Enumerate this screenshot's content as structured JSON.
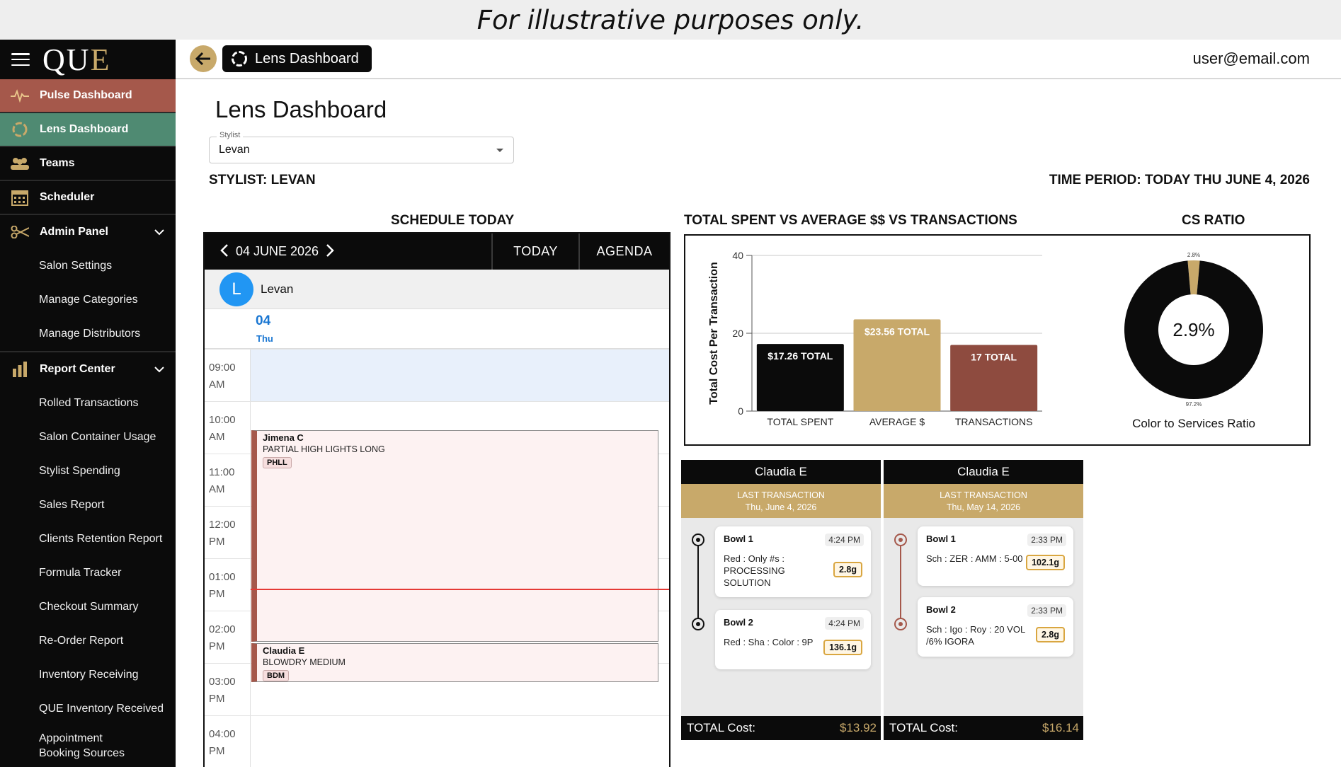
{
  "banner": "For illustrative purposes only.",
  "sidebar": {
    "logo_main": "QU",
    "logo_accent": "E",
    "items": [
      {
        "label": "Pulse Dashboard",
        "icon": "pulse-icon"
      },
      {
        "label": "Lens Dashboard",
        "icon": "lens-icon"
      },
      {
        "label": "Teams",
        "icon": "teams-icon"
      },
      {
        "label": "Scheduler",
        "icon": "calendar-icon"
      },
      {
        "label": "Admin Panel",
        "icon": "scissors-icon"
      },
      {
        "label": "Report Center",
        "icon": "bar-chart-icon"
      }
    ],
    "admin_sub": [
      "Salon Settings",
      "Manage Categories",
      "Manage Distributors"
    ],
    "report_sub": [
      "Rolled Transactions",
      "Salon Container Usage",
      "Stylist Spending",
      "Sales Report",
      "Clients Retention Report",
      "Formula Tracker",
      "Checkout Summary",
      "Re-Order Report",
      "Inventory Receiving",
      "QUE Inventory Received",
      "Appointment Booking Sources"
    ]
  },
  "topbar": {
    "crumb": "Lens Dashboard",
    "user": "user@email.com"
  },
  "page": {
    "title": "Lens Dashboard",
    "stylist_label": "Stylist",
    "stylist_value": "Levan",
    "stylist_heading": "STYLIST: LEVAN",
    "period_heading": "TIME PERIOD: TODAY THU JUNE 4, 2026"
  },
  "schedule": {
    "title": "SCHEDULE TODAY",
    "date": "04 JUNE 2026",
    "today": "TODAY",
    "agenda": "AGENDA",
    "resource_initial": "L",
    "resource_name": "Levan",
    "day_num": "04",
    "day_name": "Thu",
    "times": [
      {
        "h": "09:00",
        "ap": "AM"
      },
      {
        "h": "10:00",
        "ap": "AM"
      },
      {
        "h": "11:00",
        "ap": "AM"
      },
      {
        "h": "12:00",
        "ap": "PM"
      },
      {
        "h": "01:00",
        "ap": "PM"
      },
      {
        "h": "02:00",
        "ap": "PM"
      },
      {
        "h": "03:00",
        "ap": "PM"
      },
      {
        "h": "04:00",
        "ap": "PM"
      }
    ],
    "appointments": [
      {
        "client": "Jimena C",
        "service": "PARTIAL HIGH LIGHTS LONG",
        "code": "PHLL"
      },
      {
        "client": "Claudia E",
        "service": "BLOWDRY MEDIUM",
        "code": "BDM"
      }
    ]
  },
  "chart_title": "TOTAL SPENT VS AVERAGE $$ VS TRANSACTIONS",
  "cs_title": "CS RATIO",
  "chart_data": [
    {
      "type": "bar",
      "categories": [
        "TOTAL SPENT",
        "AVERAGE $",
        "TRANSACTIONS"
      ],
      "values": [
        17.26,
        23.56,
        17
      ],
      "data_labels": [
        "$17.26 TOTAL",
        "$23.56 TOTAL",
        "17 TOTAL"
      ],
      "colors": [
        "#0b0b0b",
        "#c8a96a",
        "#8e4b3f"
      ],
      "ylabel": "Total Cost Per Transaction",
      "ylim": [
        0,
        40
      ],
      "yticks": [
        0,
        20,
        40
      ],
      "grid": true
    },
    {
      "type": "pie",
      "donut": true,
      "categories": [
        "Color",
        "Services"
      ],
      "values": [
        2.8,
        97.2
      ],
      "slice_labels": [
        "2.8%",
        "97.2%"
      ],
      "center_label": "2.9%",
      "caption": "Color to Services Ratio",
      "colors": [
        "#c8a96a",
        "#0b0b0b"
      ]
    }
  ],
  "transactions": [
    {
      "name": "Claudia E",
      "last_label": "LAST TRANSACTION",
      "date": "Thu, June 4, 2026",
      "bowls": [
        {
          "title": "Bowl 1",
          "time": "4:24 PM",
          "desc": "Red : Only #s : PROCESSING SOLUTION",
          "weight": "2.8g"
        },
        {
          "title": "Bowl 2",
          "time": "4:24 PM",
          "desc": "Red : Sha : Color : 9P",
          "weight": "136.1g"
        }
      ],
      "total_label": "TOTAL Cost:",
      "total": "$13.92"
    },
    {
      "name": "Claudia E",
      "last_label": "LAST TRANSACTION",
      "date": "Thu, May 14, 2026",
      "bowls": [
        {
          "title": "Bowl 1",
          "time": "2:33 PM",
          "desc": "Sch : ZER : AMM : 5-00",
          "weight": "102.1g"
        },
        {
          "title": "Bowl 2",
          "time": "2:33 PM",
          "desc": "Sch : Igo : Roy : 20 VOL /6% IGORA",
          "weight": "2.8g"
        }
      ],
      "total_label": "TOTAL Cost:",
      "total": "$16.14"
    }
  ]
}
